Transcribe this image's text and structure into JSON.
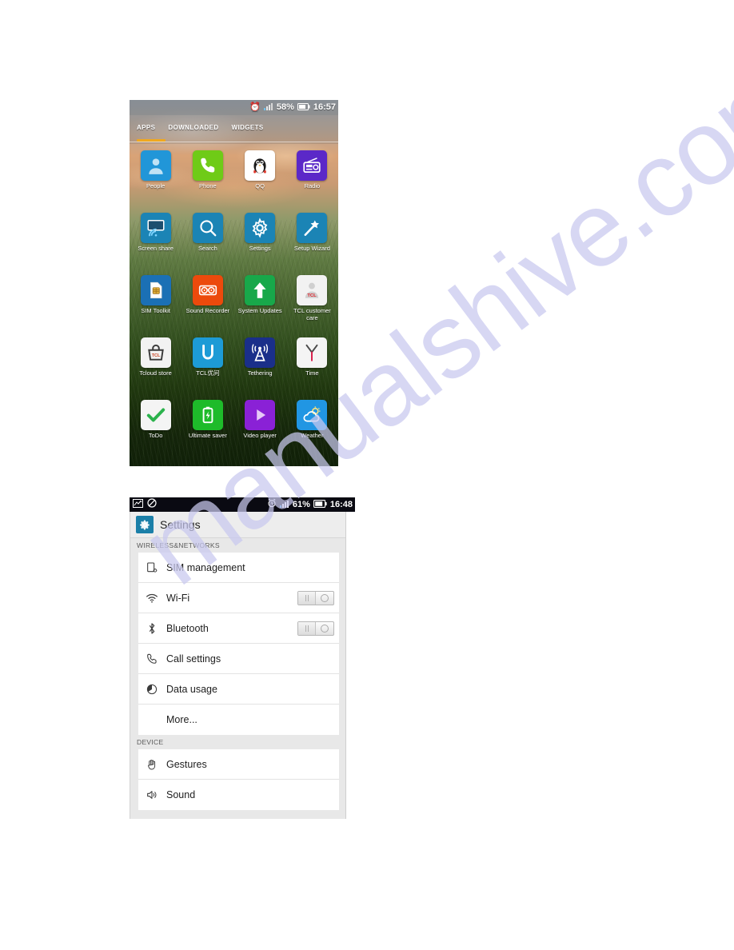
{
  "page": {
    "watermark_text": "manualshive.com",
    "watermark_color": "#c9c9ef",
    "background": "#ffffff"
  },
  "app_drawer": {
    "statusbar": {
      "alarm_icon": "alarm-clock-icon",
      "signal_icon": "signal-bars-icon",
      "battery_percent": "58%",
      "battery_icon": "battery-icon",
      "time": "16:57"
    },
    "tabs": [
      {
        "label": "APPS",
        "selected": true
      },
      {
        "label": "DOWNLOADED",
        "selected": false
      },
      {
        "label": "WIDGETS",
        "selected": false
      }
    ],
    "tab_indicator_color": "#f0a81e",
    "rows": [
      [
        {
          "label": "People",
          "icon": "contacts-person-icon",
          "bg": "#2196d8",
          "fg": "#bfe2f5"
        },
        {
          "label": "Phone",
          "icon": "phone-handset-icon",
          "bg": "#6fcb17",
          "fg": "#ffffff"
        },
        {
          "label": "QQ",
          "icon": "qq-penguin-icon",
          "bg": "#ffffff",
          "fg": "#1a1a1a"
        },
        {
          "label": "Radio",
          "icon": "radio-icon",
          "bg": "#5b28c8",
          "fg": "#ffffff"
        }
      ],
      [
        {
          "label": "Screen share",
          "icon": "screen-share-icon",
          "bg": "#1b84b5",
          "fg": "#ffffff"
        },
        {
          "label": "Search",
          "icon": "magnifier-icon",
          "bg": "#1b84b5",
          "fg": "#ffffff"
        },
        {
          "label": "Settings",
          "icon": "gear-icon",
          "bg": "#1b84b5",
          "fg": "#ffffff"
        },
        {
          "label": "Setup Wizard",
          "icon": "magic-wand-icon",
          "bg": "#1b84b5",
          "fg": "#ffffff"
        }
      ],
      [
        {
          "label": "SIM Toolkit",
          "icon": "sim-card-icon",
          "bg": "#1b70b5",
          "fg": "#ffffff"
        },
        {
          "label": "Sound Recorder",
          "icon": "tape-recorder-icon",
          "bg": "#ec4a0c",
          "fg": "#ffffff"
        },
        {
          "label": "System Updates",
          "icon": "up-arrow-icon",
          "bg": "#18a84a",
          "fg": "#ffffff"
        },
        {
          "label": "TCL customer care",
          "icon": "tcl-person-icon",
          "bg": "#f2f2f2",
          "fg": "#e01b24"
        }
      ],
      [
        {
          "label": "Tcloud store",
          "icon": "shopping-bag-icon",
          "bg": "#f2f2f2",
          "fg": "#3a3a3a"
        },
        {
          "label": "TCL优问",
          "icon": "letter-u-icon",
          "bg": "#1d9bd6",
          "fg": "#ffffff"
        },
        {
          "label": "Tethering",
          "icon": "broadcast-tower-icon",
          "bg": "#1a2f8a",
          "fg": "#ffffff"
        },
        {
          "label": "Time",
          "icon": "y-clock-icon",
          "bg": "#f4f4f4",
          "fg": "#d81d4a"
        }
      ],
      [
        {
          "label": "ToDo",
          "icon": "checkmark-icon",
          "bg": "#f4f4f4",
          "fg": "#2bb24c"
        },
        {
          "label": "Ultimate saver",
          "icon": "battery-bolt-icon",
          "bg": "#1ebb2a",
          "fg": "#ffffff"
        },
        {
          "label": "Video player",
          "icon": "play-triangle-icon",
          "bg": "#8a21d6",
          "fg": "#e6c9f7"
        },
        {
          "label": "Weather",
          "icon": "cloud-sun-icon",
          "bg": "#2196e3",
          "fg": "#ffffff"
        }
      ]
    ]
  },
  "settings": {
    "statusbar": {
      "gallery_icon": "gallery-image-icon",
      "mute_icon": "mute-slash-icon",
      "alarm_icon": "alarm-clock-icon",
      "signal_icon": "signal-bars-icon",
      "battery_percent": "61%",
      "battery_icon": "battery-icon",
      "time": "16:48"
    },
    "title": "Settings",
    "title_icon": "gear-icon",
    "title_icon_bg": "#1b7fa8",
    "sections": [
      {
        "header": "WIRELESS&NETWORKS",
        "items": [
          {
            "label": "SIM management",
            "icon": "sim-management-icon",
            "toggle": false,
            "indent": false
          },
          {
            "label": "Wi-Fi",
            "icon": "wifi-icon",
            "toggle": true,
            "indent": false,
            "toggle_state": "off"
          },
          {
            "label": "Bluetooth",
            "icon": "bluetooth-icon",
            "toggle": true,
            "indent": false,
            "toggle_state": "off"
          },
          {
            "label": "Call settings",
            "icon": "phone-handset-icon",
            "toggle": false,
            "indent": false
          },
          {
            "label": "Data usage",
            "icon": "data-usage-pie-icon",
            "toggle": false,
            "indent": false
          },
          {
            "label": "More...",
            "icon": "none",
            "toggle": false,
            "indent": true
          }
        ]
      },
      {
        "header": "DEVICE",
        "items": [
          {
            "label": "Gestures",
            "icon": "hand-gesture-icon",
            "toggle": false,
            "indent": false
          },
          {
            "label": "Sound",
            "icon": "speaker-icon",
            "toggle": false,
            "indent": false
          }
        ]
      }
    ]
  }
}
